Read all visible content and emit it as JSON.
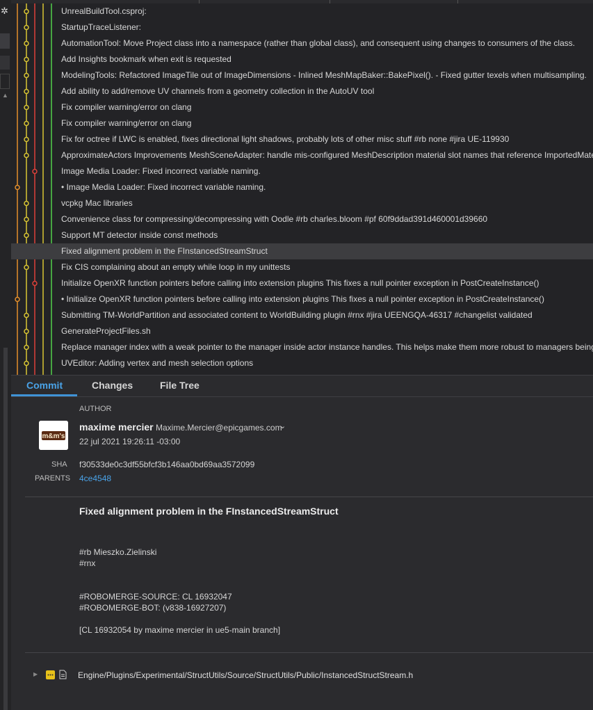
{
  "commits": [
    {
      "message": "UnrealBuildTool.csproj:"
    },
    {
      "message": "StartupTraceListener:"
    },
    {
      "message": "AutomationTool: Move Project class into a namespace (rather than global class), and consequent using changes to consumers of the class."
    },
    {
      "message": "Add Insights bookmark when exit is requested"
    },
    {
      "message": "ModelingTools: Refactored ImageTile out of ImageDimensions - Inlined MeshMapBaker::BakePixel(). - Fixed gutter texels when multisampling."
    },
    {
      "message": "Add ability to add/remove UV channels from a geometry collection in the AutoUV tool"
    },
    {
      "message": "Fix compiler warning/error on clang"
    },
    {
      "message": "Fix compiler warning/error on clang"
    },
    {
      "message": "Fix for octree if LWC is enabled, fixes directional light shadows, probably lots of other misc stuff #rb none #jira UE-119930"
    },
    {
      "message": "ApproximateActors Improvements MeshSceneAdapter: handle mis-configured MeshDescription material slot names that reference ImportedMate"
    },
    {
      "message": "Image Media Loader: Fixed incorrect variable naming."
    },
    {
      "message": "• Image Media Loader: Fixed incorrect variable naming."
    },
    {
      "message": "vcpkg Mac libraries"
    },
    {
      "message": "Convenience class for compressing/decompressing with Oodle #rb charles.bloom #pf 60f9ddad391d460001d39660"
    },
    {
      "message": "Support MT detector inside const methods"
    },
    {
      "message": "Fixed alignment problem in the FInstancedStreamStruct"
    },
    {
      "message": "Fix CIS complaining about an empty while loop in my unittests"
    },
    {
      "message": "Initialize OpenXR function pointers before calling into extension plugins This fixes a null pointer exception in PostCreateInstance()"
    },
    {
      "message": "• Initialize OpenXR function pointers before calling into extension plugins This fixes a null pointer exception in PostCreateInstance()"
    },
    {
      "message": "Submitting TM-WorldPartition and associated content to WorldBuilding plugin #rnx #jira UEENGQA-46317 #changelist validated"
    },
    {
      "message": "GenerateProjectFiles.sh"
    },
    {
      "message": "Replace manager index with a weak pointer to the manager inside actor instance handles. This helps make them more robust to managers being"
    },
    {
      "message": "UVEditor: Adding vertex and mesh selection options"
    }
  ],
  "selected_index": 15,
  "tabs": {
    "commit": "Commit",
    "changes": "Changes",
    "file_tree": "File Tree"
  },
  "detail": {
    "author_label": "AUTHOR",
    "avatar_text": "m&m's",
    "author_name": "maxime mercier",
    "author_email": "Maxime.Mercier@epicgames.com",
    "date": "22 jul 2021 19:26:11 -03:00",
    "sha_label": "SHA",
    "sha": "f30533de0c3df55bfcf3b146aa0bd69aa3572099",
    "parents_label": "PARENTS",
    "parent": "4ce4548",
    "title": "Fixed alignment problem in the FInstancedStreamStruct",
    "body_lines": [
      "#rb Mieszko.Zielinski",
      "#rnx"
    ],
    "robomerge_lines": [
      "#ROBOMERGE-SOURCE: CL 16932047",
      "#ROBOMERGE-BOT: (v838-16927207)"
    ],
    "cl_line": "[CL 16932054 by maxime mercier in ue5-main branch]",
    "file_path": "Engine/Plugins/Experimental/StructUtils/Source/StructUtils/Public/InstancedStructStream.h"
  },
  "colors": {
    "lane_orange": "#e5902c",
    "lane_yellow": "#d9c633",
    "lane_red": "#e0413a",
    "lane_green": "#52cf4a",
    "accent": "#4aa3e8"
  }
}
